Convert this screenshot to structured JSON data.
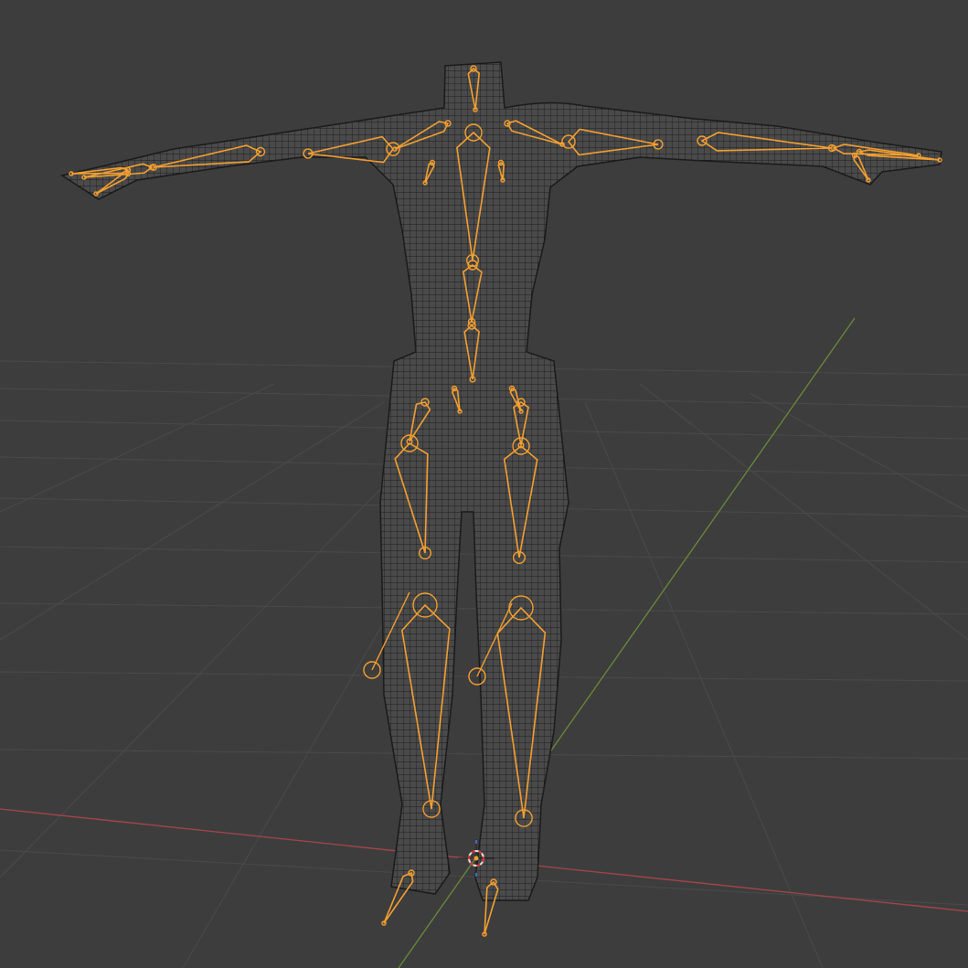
{
  "viewport": {
    "mode": "armature-over-wireframe-mesh",
    "colors": {
      "background": "#3d3d3d",
      "grid": "#4a4a4a",
      "x_axis": "#a8454d",
      "y_axis": "#6b8a3a",
      "mesh_fill": "#474747",
      "mesh_wire": "#1e1e1e",
      "bone": "#f5a030",
      "cursor_ring_red": "#d03030",
      "cursor_ring_white": "#e0e0e0"
    },
    "icons": {
      "cursor": "3d-cursor-icon"
    }
  }
}
